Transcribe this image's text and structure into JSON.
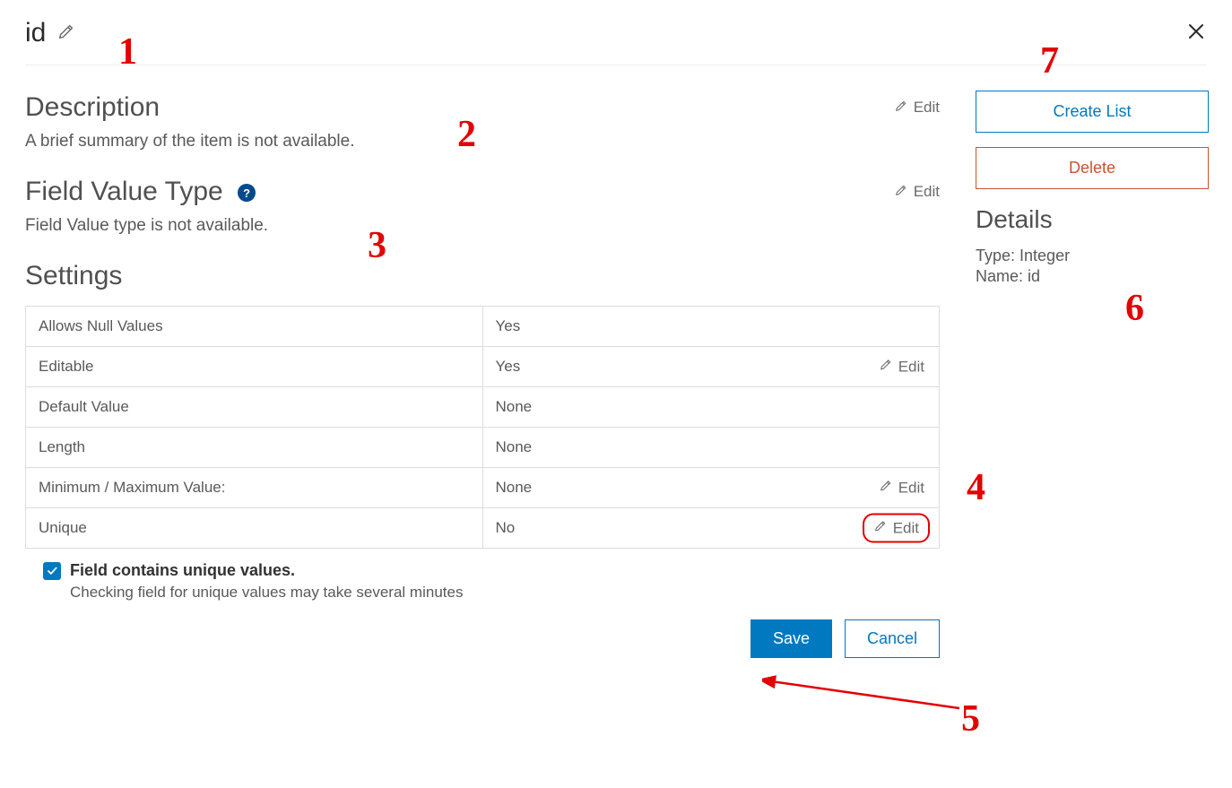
{
  "header": {
    "title": "id"
  },
  "sections": {
    "description_heading": "Description",
    "description_text": "A brief summary of the item is not available.",
    "fieldvalue_heading": "Field Value Type",
    "fieldvalue_text": "Field Value type is not available.",
    "settings_heading": "Settings"
  },
  "edit_label": "Edit",
  "settings_rows": {
    "allow_nulls": {
      "label": "Allows Null Values",
      "value": "Yes"
    },
    "editable": {
      "label": "Editable",
      "value": "Yes"
    },
    "default": {
      "label": "Default Value",
      "value": "None"
    },
    "length": {
      "label": "Length",
      "value": "None"
    },
    "minmax": {
      "label": "Minimum / Maximum Value:",
      "value": "None"
    },
    "unique": {
      "label": "Unique",
      "value": "No"
    }
  },
  "unique_check": {
    "label": "Field contains unique values.",
    "sub": "Checking field for unique values may take several minutes",
    "checked": true
  },
  "buttons": {
    "save": "Save",
    "cancel": "Cancel"
  },
  "side": {
    "create_list": "Create List",
    "delete": "Delete",
    "details_heading": "Details",
    "type_label": "Type: ",
    "type_value": "Integer",
    "name_label": "Name: ",
    "name_value": "id"
  },
  "callouts": {
    "c1": "1",
    "c2": "2",
    "c3": "3",
    "c4": "4",
    "c5": "5",
    "c6": "6",
    "c7": "7"
  }
}
